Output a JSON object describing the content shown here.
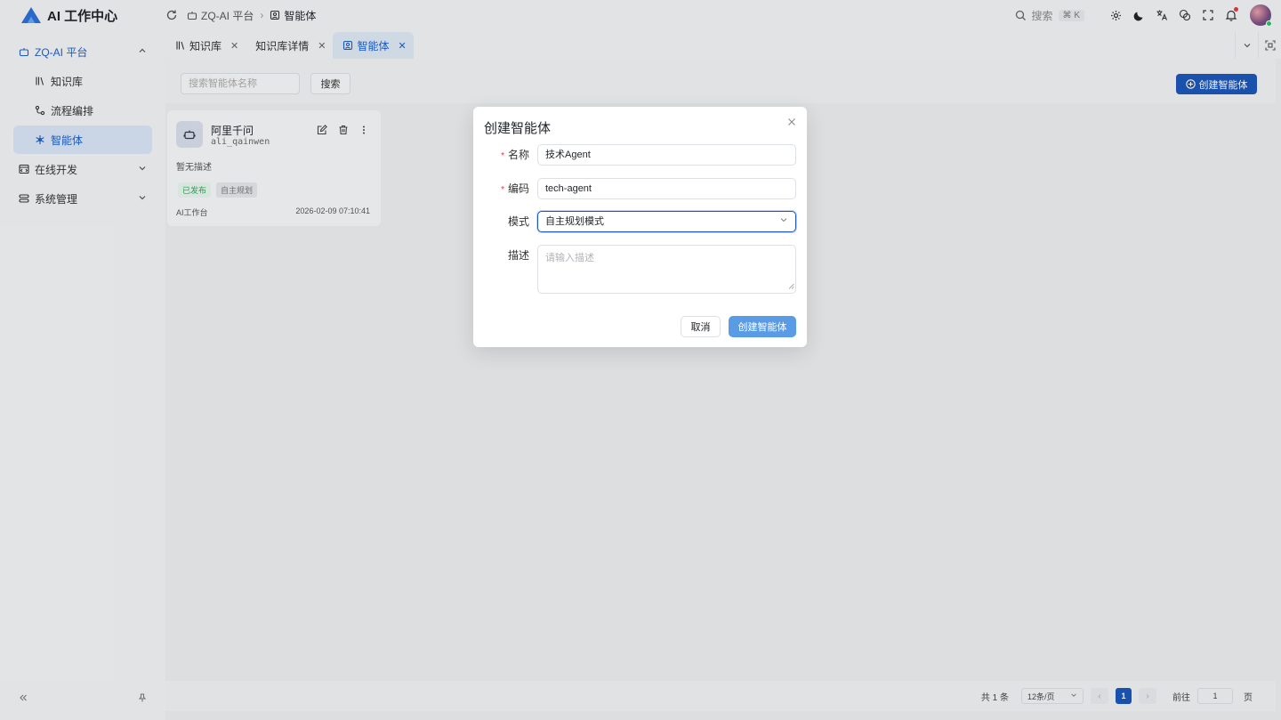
{
  "app": {
    "title": "AI 工作中心"
  },
  "breadcrumb": {
    "items": [
      "ZQ-AI 平台",
      "智能体"
    ]
  },
  "header": {
    "search_label": "搜索",
    "search_shortcut": "⌘ K"
  },
  "sidebar": {
    "groups": [
      {
        "label": "ZQ-AI 平台",
        "expanded": true,
        "icon": "bot-icon",
        "items": [
          {
            "label": "知识库",
            "icon": "library-icon"
          },
          {
            "label": "流程编排",
            "icon": "workflow-icon"
          },
          {
            "label": "智能体",
            "icon": "snowflake-icon",
            "active": true
          }
        ]
      },
      {
        "label": "在线开发",
        "expanded": false,
        "icon": "code-icon"
      },
      {
        "label": "系统管理",
        "expanded": false,
        "icon": "settings-list-icon"
      }
    ]
  },
  "tabs": [
    {
      "label": "知识库",
      "icon": "library-icon",
      "active": false
    },
    {
      "label": "知识库详情",
      "active": false
    },
    {
      "label": "智能体",
      "icon": "agent-icon",
      "active": true
    }
  ],
  "toolbar": {
    "search_placeholder": "搜索智能体名称",
    "search_button": "搜索",
    "create_button": "创建智能体"
  },
  "cards": [
    {
      "name": "阿里千问",
      "code": "ali_qainwen",
      "description": "暂无描述",
      "status": "已发布",
      "mode": "自主规划",
      "source": "AI工作台",
      "updated_at": "2026-02-09 07:10:41"
    }
  ],
  "pagination": {
    "total_text": "共 1 条",
    "page_size": "12条/页",
    "current_page": "1",
    "goto_label": "前往",
    "goto_value": "1",
    "page_suffix": "页"
  },
  "modal": {
    "title": "创建智能体",
    "fields": {
      "name": {
        "label": "名称",
        "required": true,
        "value": "技术Agent"
      },
      "code": {
        "label": "编码",
        "required": true,
        "value": "tech-agent"
      },
      "mode": {
        "label": "模式",
        "value": "自主规划模式"
      },
      "description": {
        "label": "描述",
        "placeholder": "请输入描述"
      }
    },
    "cancel_button": "取消",
    "submit_button": "创建智能体"
  },
  "colors": {
    "primary": "#1c56b8",
    "submit_disabled": "#5a9be6",
    "required": "#e5363f",
    "published": "#27a85a"
  }
}
